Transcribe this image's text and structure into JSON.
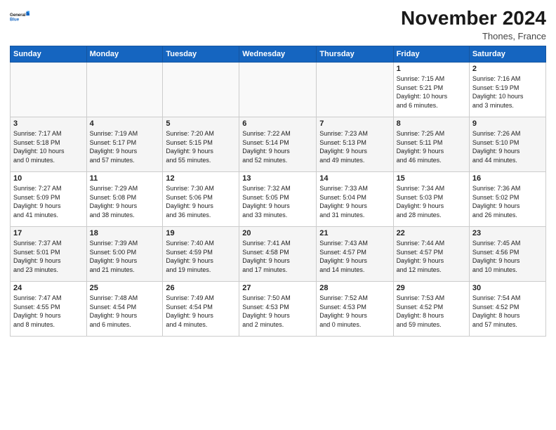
{
  "logo": {
    "line1": "General",
    "line2": "Blue"
  },
  "title": "November 2024",
  "location": "Thones, France",
  "days_of_week": [
    "Sunday",
    "Monday",
    "Tuesday",
    "Wednesday",
    "Thursday",
    "Friday",
    "Saturday"
  ],
  "rows": [
    [
      {
        "day": "",
        "info": ""
      },
      {
        "day": "",
        "info": ""
      },
      {
        "day": "",
        "info": ""
      },
      {
        "day": "",
        "info": ""
      },
      {
        "day": "",
        "info": ""
      },
      {
        "day": "1",
        "info": "Sunrise: 7:15 AM\nSunset: 5:21 PM\nDaylight: 10 hours\nand 6 minutes."
      },
      {
        "day": "2",
        "info": "Sunrise: 7:16 AM\nSunset: 5:19 PM\nDaylight: 10 hours\nand 3 minutes."
      }
    ],
    [
      {
        "day": "3",
        "info": "Sunrise: 7:17 AM\nSunset: 5:18 PM\nDaylight: 10 hours\nand 0 minutes."
      },
      {
        "day": "4",
        "info": "Sunrise: 7:19 AM\nSunset: 5:17 PM\nDaylight: 9 hours\nand 57 minutes."
      },
      {
        "day": "5",
        "info": "Sunrise: 7:20 AM\nSunset: 5:15 PM\nDaylight: 9 hours\nand 55 minutes."
      },
      {
        "day": "6",
        "info": "Sunrise: 7:22 AM\nSunset: 5:14 PM\nDaylight: 9 hours\nand 52 minutes."
      },
      {
        "day": "7",
        "info": "Sunrise: 7:23 AM\nSunset: 5:13 PM\nDaylight: 9 hours\nand 49 minutes."
      },
      {
        "day": "8",
        "info": "Sunrise: 7:25 AM\nSunset: 5:11 PM\nDaylight: 9 hours\nand 46 minutes."
      },
      {
        "day": "9",
        "info": "Sunrise: 7:26 AM\nSunset: 5:10 PM\nDaylight: 9 hours\nand 44 minutes."
      }
    ],
    [
      {
        "day": "10",
        "info": "Sunrise: 7:27 AM\nSunset: 5:09 PM\nDaylight: 9 hours\nand 41 minutes."
      },
      {
        "day": "11",
        "info": "Sunrise: 7:29 AM\nSunset: 5:08 PM\nDaylight: 9 hours\nand 38 minutes."
      },
      {
        "day": "12",
        "info": "Sunrise: 7:30 AM\nSunset: 5:06 PM\nDaylight: 9 hours\nand 36 minutes."
      },
      {
        "day": "13",
        "info": "Sunrise: 7:32 AM\nSunset: 5:05 PM\nDaylight: 9 hours\nand 33 minutes."
      },
      {
        "day": "14",
        "info": "Sunrise: 7:33 AM\nSunset: 5:04 PM\nDaylight: 9 hours\nand 31 minutes."
      },
      {
        "day": "15",
        "info": "Sunrise: 7:34 AM\nSunset: 5:03 PM\nDaylight: 9 hours\nand 28 minutes."
      },
      {
        "day": "16",
        "info": "Sunrise: 7:36 AM\nSunset: 5:02 PM\nDaylight: 9 hours\nand 26 minutes."
      }
    ],
    [
      {
        "day": "17",
        "info": "Sunrise: 7:37 AM\nSunset: 5:01 PM\nDaylight: 9 hours\nand 23 minutes."
      },
      {
        "day": "18",
        "info": "Sunrise: 7:39 AM\nSunset: 5:00 PM\nDaylight: 9 hours\nand 21 minutes."
      },
      {
        "day": "19",
        "info": "Sunrise: 7:40 AM\nSunset: 4:59 PM\nDaylight: 9 hours\nand 19 minutes."
      },
      {
        "day": "20",
        "info": "Sunrise: 7:41 AM\nSunset: 4:58 PM\nDaylight: 9 hours\nand 17 minutes."
      },
      {
        "day": "21",
        "info": "Sunrise: 7:43 AM\nSunset: 4:57 PM\nDaylight: 9 hours\nand 14 minutes."
      },
      {
        "day": "22",
        "info": "Sunrise: 7:44 AM\nSunset: 4:57 PM\nDaylight: 9 hours\nand 12 minutes."
      },
      {
        "day": "23",
        "info": "Sunrise: 7:45 AM\nSunset: 4:56 PM\nDaylight: 9 hours\nand 10 minutes."
      }
    ],
    [
      {
        "day": "24",
        "info": "Sunrise: 7:47 AM\nSunset: 4:55 PM\nDaylight: 9 hours\nand 8 minutes."
      },
      {
        "day": "25",
        "info": "Sunrise: 7:48 AM\nSunset: 4:54 PM\nDaylight: 9 hours\nand 6 minutes."
      },
      {
        "day": "26",
        "info": "Sunrise: 7:49 AM\nSunset: 4:54 PM\nDaylight: 9 hours\nand 4 minutes."
      },
      {
        "day": "27",
        "info": "Sunrise: 7:50 AM\nSunset: 4:53 PM\nDaylight: 9 hours\nand 2 minutes."
      },
      {
        "day": "28",
        "info": "Sunrise: 7:52 AM\nSunset: 4:53 PM\nDaylight: 9 hours\nand 0 minutes."
      },
      {
        "day": "29",
        "info": "Sunrise: 7:53 AM\nSunset: 4:52 PM\nDaylight: 8 hours\nand 59 minutes."
      },
      {
        "day": "30",
        "info": "Sunrise: 7:54 AM\nSunset: 4:52 PM\nDaylight: 8 hours\nand 57 minutes."
      }
    ]
  ]
}
